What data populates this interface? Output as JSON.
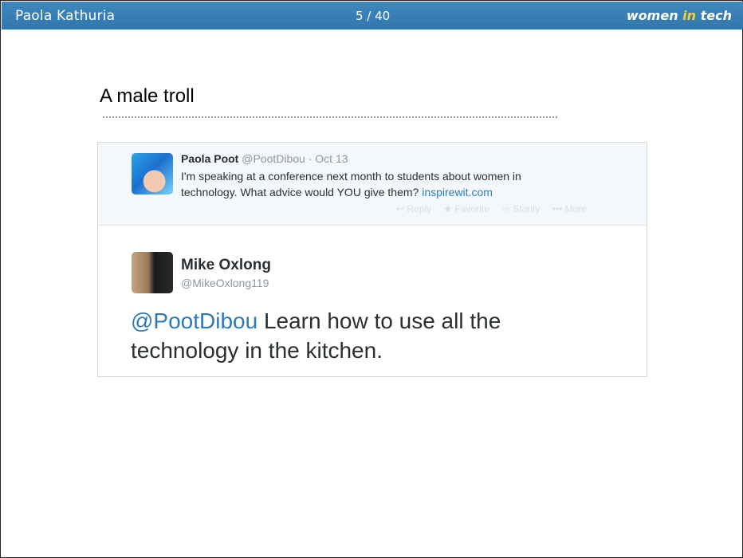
{
  "header": {
    "presenter": "Paola Kathuria",
    "page": "5 / 40",
    "brand_part1": "women ",
    "brand_part2": "in",
    "brand_part3": " tech",
    "brand_color": "#2f77ad"
  },
  "slide": {
    "title": "A male troll"
  },
  "original_tweet": {
    "name": "Paola Poot",
    "handle": "@PootDibou",
    "separator": "·",
    "date": "Oct 13",
    "text": "I'm speaking at a conference next month to students about women in technology. What advice would YOU give them?",
    "link": "inspirewit.com",
    "actions": {
      "reply_icon": "↩",
      "reply": "Reply",
      "favorite_icon": "★",
      "favorite": "Favorite",
      "storify_icon": "♾",
      "storify": "Storify",
      "more_icon": "•••",
      "more": "More"
    }
  },
  "reply_tweet": {
    "name": "Mike Oxlong",
    "handle": "@MikeOxlong119",
    "mention": "@PootDibou",
    "text": " Learn how to use all the technology in the kitchen."
  },
  "colors": {
    "link": "#2b7bb9",
    "muted": "#8899a6",
    "brand_highlight": "#f2d23a"
  }
}
